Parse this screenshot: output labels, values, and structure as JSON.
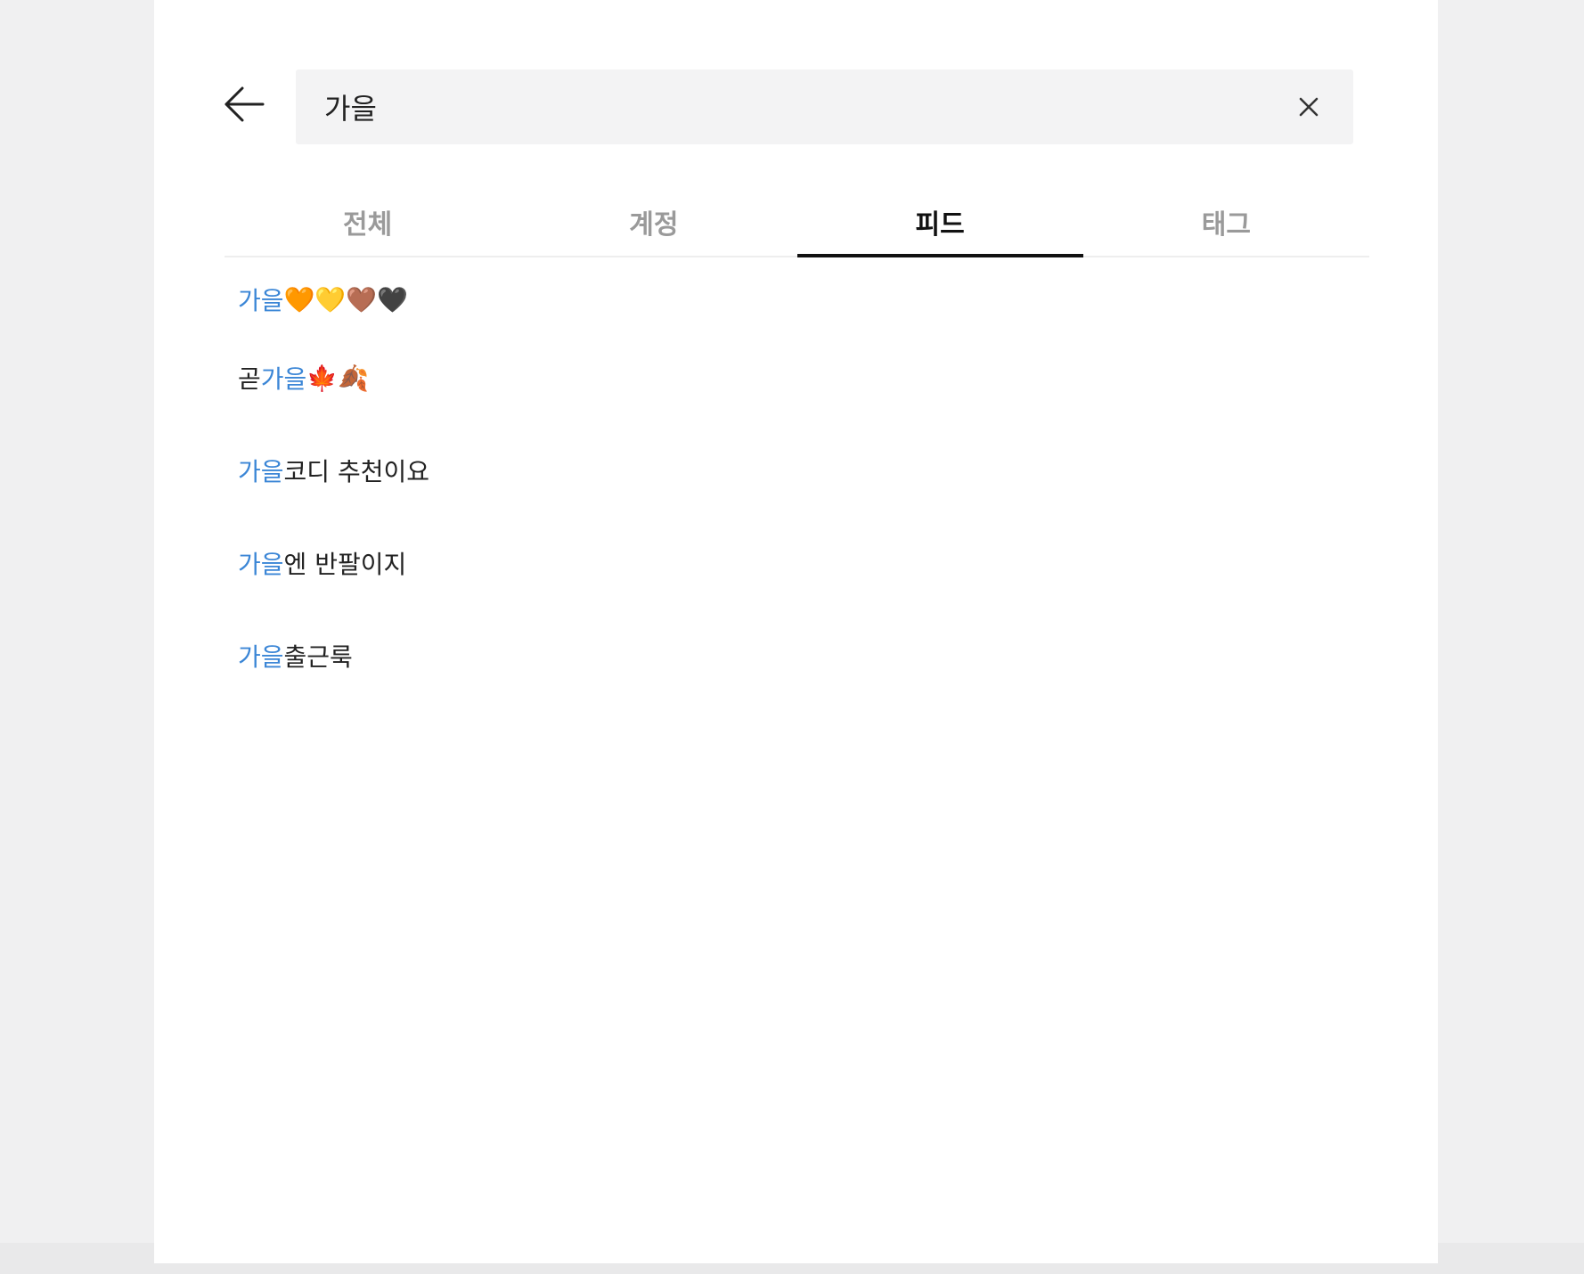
{
  "search": {
    "query": "가을"
  },
  "tabs": [
    {
      "label": "전체",
      "active": false
    },
    {
      "label": "계정",
      "active": false
    },
    {
      "label": "피드",
      "active": true
    },
    {
      "label": "태그",
      "active": false
    }
  ],
  "results": [
    {
      "before": "",
      "match": "가을",
      "after": " 🧡💛🤎🖤"
    },
    {
      "before": "곧 ",
      "match": "가을",
      "after": " 🍁🍂"
    },
    {
      "before": "",
      "match": "가을",
      "after": " 코디 추천이요"
    },
    {
      "before": "",
      "match": "가을",
      "after": " 엔 반팔이지"
    },
    {
      "before": "",
      "match": "가을",
      "after": " 출근룩"
    }
  ],
  "colors": {
    "highlight": "#3b86d6",
    "active_tab": "#111111",
    "inactive_tab": "#9a9a9a",
    "search_bg": "#f3f3f4"
  },
  "icons": {
    "back": "arrow-left-icon",
    "clear": "close-icon"
  }
}
